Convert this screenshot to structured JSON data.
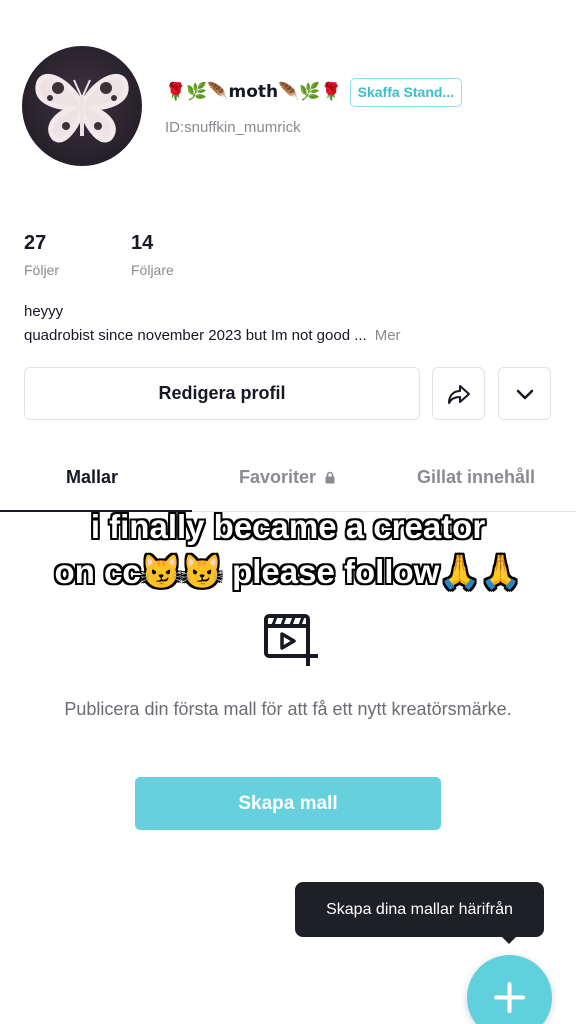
{
  "profile": {
    "display_name": "🌹🌿🪶moth🪶🌿🌹",
    "standard_button": "Skaffa Stand...",
    "user_id": "ID:snuffkin_mumrick",
    "avatar_icon": "butterfly-avatar"
  },
  "stats": {
    "following": {
      "value": "27",
      "label": "Följer"
    },
    "followers": {
      "value": "14",
      "label": "Följare"
    }
  },
  "bio": {
    "line1": "heyyy",
    "line2": "quadrobist since november 2023 but Im not good ...",
    "more": "Mer"
  },
  "actions": {
    "edit_profile": "Redigera profil",
    "share_icon": "share-arrow-icon",
    "dropdown_icon": "chevron-down-icon"
  },
  "tabs": [
    {
      "label": "Mallar",
      "active": true
    },
    {
      "label": "Favoriter",
      "active": false,
      "icon": "lock-icon"
    },
    {
      "label": "Gillat innehåll",
      "active": false
    }
  ],
  "overlay_caption": {
    "line1": "i finally became a creator",
    "line2": "on cc😼😼 please follow🙏🙏"
  },
  "empty_state": {
    "icon": "video-template-add-icon",
    "message": "Publicera din första mall för att få ett nytt kreatörsmärke.",
    "button": "Skapa mall"
  },
  "tooltip": {
    "text": "Skapa dina mallar härifrån"
  },
  "fab": {
    "icon": "plus-icon"
  },
  "colors": {
    "accent": "#5fd0dc",
    "text_primary": "#161823",
    "text_secondary": "#8a8b91",
    "tooltip_bg": "#1f2025"
  }
}
